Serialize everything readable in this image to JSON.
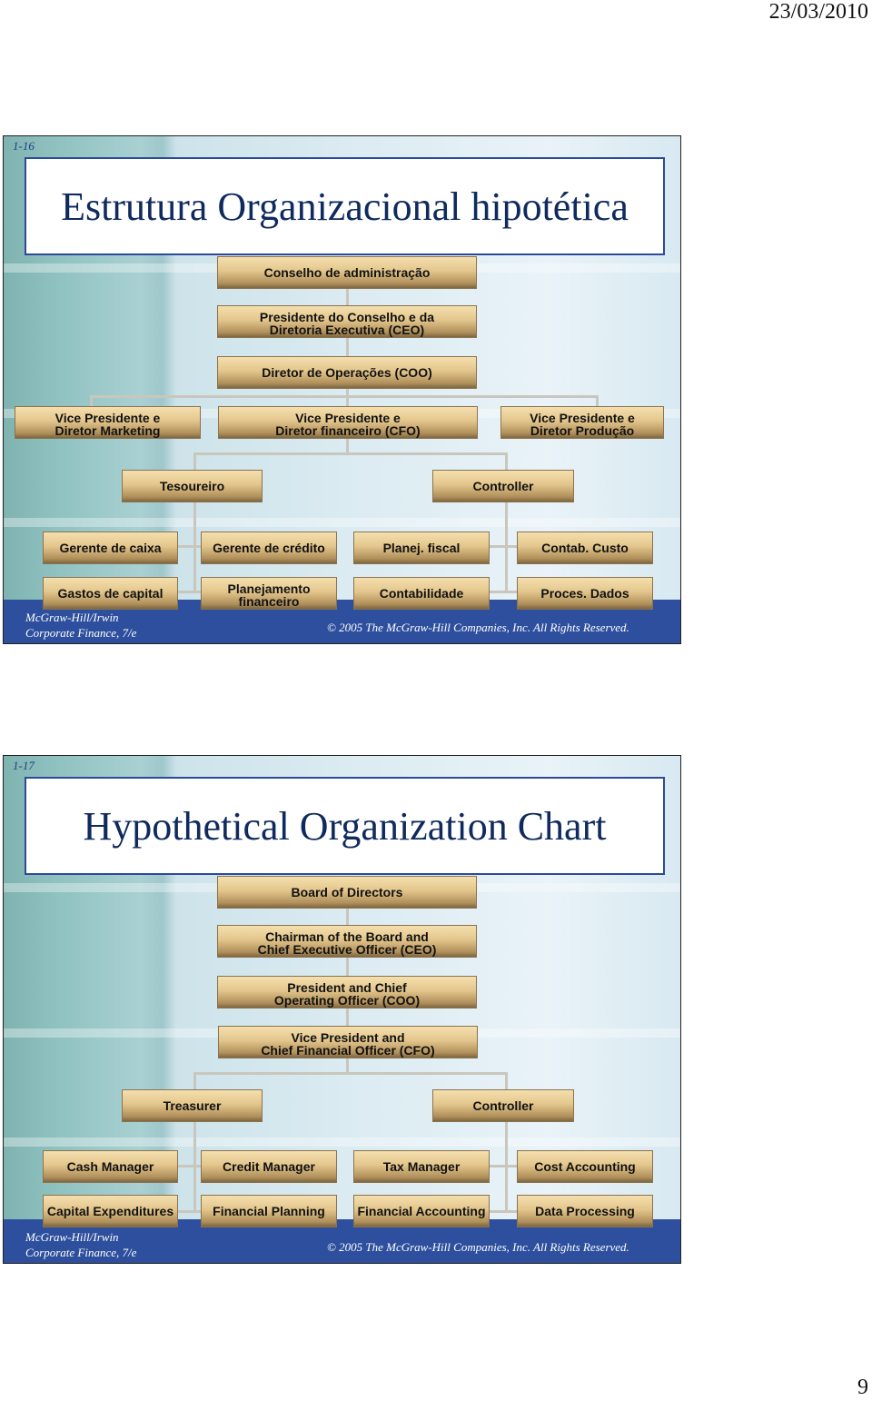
{
  "header": {
    "date": "23/03/2010"
  },
  "page_number": "9",
  "slides": [
    {
      "number": "1-16",
      "title": "Estrutura Organizacional hipotética",
      "boxes": {
        "board": "Conselho de administração",
        "ceo": "Presidente do Conselho e da\nDiretoria Executiva (CEO)",
        "coo": "Diretor de Operações (COO)",
        "vp_marketing": "Vice Presidente e\nDiretor Marketing",
        "cfo": "Vice Presidente e\nDiretor financeiro (CFO)",
        "vp_production": "Vice Presidente e\nDiretor Produção",
        "treasurer": "Tesoureiro",
        "controller": "Controller",
        "cash_manager": "Gerente de caixa",
        "credit_manager": "Gerente de crédito",
        "tax_manager": "Planej. fiscal",
        "cost_accounting": "Contab. Custo",
        "capital_expenditures": "Gastos de capital",
        "financial_planning": "Planejamento\nfinanceiro",
        "financial_accounting": "Contabilidade",
        "data_processing": "Proces. Dados"
      },
      "footer": {
        "publisher": "McGraw-Hill/Irwin",
        "book": "Corporate Finance, 7/e",
        "copyright": "© 2005  The McGraw-Hill Companies, Inc.  All Rights Reserved."
      }
    },
    {
      "number": "1-17",
      "title": "Hypothetical Organization Chart",
      "boxes": {
        "board": "Board of Directors",
        "ceo": "Chairman of the Board and\nChief Executive Officer (CEO)",
        "coo": "President and Chief\nOperating Officer (COO)",
        "cfo": "Vice President and\nChief Financial Officer (CFO)",
        "treasurer": "Treasurer",
        "controller": "Controller",
        "cash_manager": "Cash Manager",
        "credit_manager": "Credit Manager",
        "tax_manager": "Tax Manager",
        "cost_accounting": "Cost Accounting",
        "capital_expenditures": "Capital Expenditures",
        "financial_planning": "Financial Planning",
        "financial_accounting": "Financial Accounting",
        "data_processing": "Data Processing"
      },
      "footer": {
        "publisher": "McGraw-Hill/Irwin",
        "book": "Corporate Finance, 7/e",
        "copyright": "© 2005  The McGraw-Hill Companies, Inc.  All Rights Reserved."
      }
    }
  ]
}
